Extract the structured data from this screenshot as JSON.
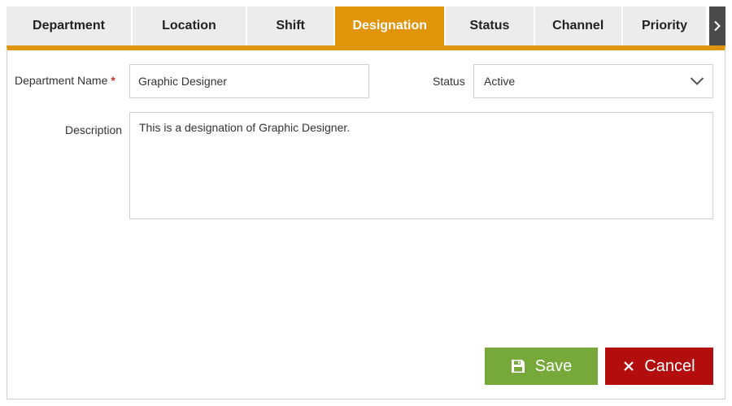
{
  "tabs": [
    {
      "label": "Department"
    },
    {
      "label": "Location"
    },
    {
      "label": "Shift"
    },
    {
      "label": "Designation"
    },
    {
      "label": "Status"
    },
    {
      "label": "Channel"
    },
    {
      "label": "Priority"
    }
  ],
  "active_tab": "Designation",
  "form": {
    "name_label": "Department Name",
    "required_marker": "*",
    "name_value": "Graphic Designer",
    "status_label": "Status",
    "status_value": "Active",
    "description_label": "Description",
    "description_value": "This is a designation of Graphic Designer."
  },
  "actions": {
    "save_label": "Save",
    "cancel_label": "Cancel"
  },
  "colors": {
    "accent": "#e0940a",
    "save": "#76a83a",
    "cancel": "#b30d0d",
    "tab_inactive": "#ececec",
    "tab_next": "#4a4a4a"
  },
  "icons": {
    "tab_next": "chevron-right-icon",
    "status_dropdown": "chevron-down-icon",
    "save": "floppy-disk-icon",
    "cancel": "close-icon"
  }
}
